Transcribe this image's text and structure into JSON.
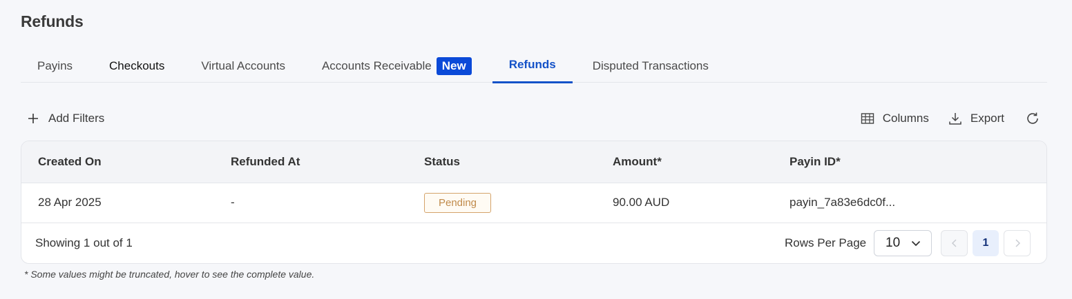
{
  "page": {
    "title": "Refunds"
  },
  "tabs": [
    {
      "label": "Payins"
    },
    {
      "label": "Checkouts"
    },
    {
      "label": "Virtual Accounts"
    },
    {
      "label": "Accounts Receivable",
      "badge": "New"
    },
    {
      "label": "Refunds",
      "active": true
    },
    {
      "label": "Disputed Transactions"
    }
  ],
  "toolbar": {
    "add_filters": "Add Filters",
    "columns": "Columns",
    "export": "Export",
    "icons": [
      "plus-icon",
      "table-grid-icon",
      "download-icon",
      "refresh-icon"
    ]
  },
  "table": {
    "headers": [
      "Created On",
      "Refunded At",
      "Status",
      "Amount*",
      "Payin ID*"
    ],
    "rows": [
      {
        "created_on": "28 Apr 2025",
        "refunded_at": "-",
        "status": "Pending",
        "amount": "90.00 AUD",
        "payin_id": "payin_7a83e6dc0f..."
      }
    ]
  },
  "pagination": {
    "showing": "Showing 1 out of 1",
    "rows_per_page_label": "Rows Per Page",
    "rows_per_page_value": "10",
    "current_page": "1"
  },
  "footnote": "* Some values might be truncated, hover to see the complete value.",
  "colors": {
    "accent": "#1452c8",
    "badge_bg": "#0b4ad8",
    "pending_border": "#d4a36a",
    "pending_text": "#c08a4a",
    "background": "#f6f7fa"
  }
}
